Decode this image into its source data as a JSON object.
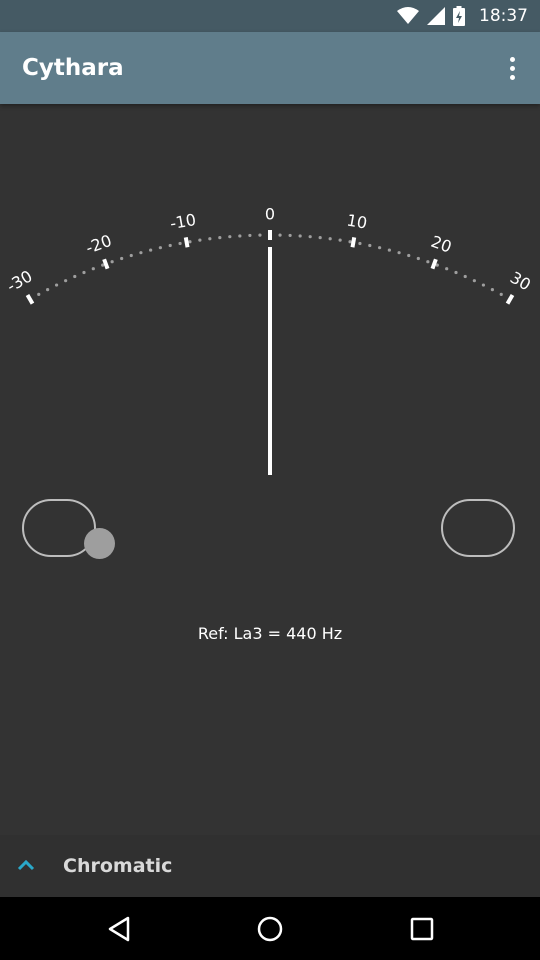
{
  "status_bar": {
    "time": "18:37",
    "icons": [
      "wifi-icon",
      "cell-signal-icon",
      "battery-charging-icon"
    ]
  },
  "app_bar": {
    "title": "Cythara",
    "overflow_icon": "more-vert-icon"
  },
  "tuner": {
    "scale_labels": [
      "-30",
      "-20",
      "-10",
      "0",
      "10",
      "20",
      "30"
    ],
    "scale_values": [
      -30,
      -20,
      -10,
      0,
      10,
      20,
      30
    ],
    "needle_value": 0,
    "left_indicator_on": true,
    "right_indicator_on": false
  },
  "reference": {
    "text": "Ref: La3 = 440 Hz"
  },
  "mode": {
    "label": "Chromatic",
    "icon": "chevron-up-icon",
    "accent_color": "#2aa8c9"
  },
  "colors": {
    "background": "#333333",
    "app_bar": "#607d8b",
    "status_bar": "#455a64"
  },
  "nav_bar": {
    "icons": [
      "back-icon",
      "home-icon",
      "recents-icon"
    ]
  }
}
